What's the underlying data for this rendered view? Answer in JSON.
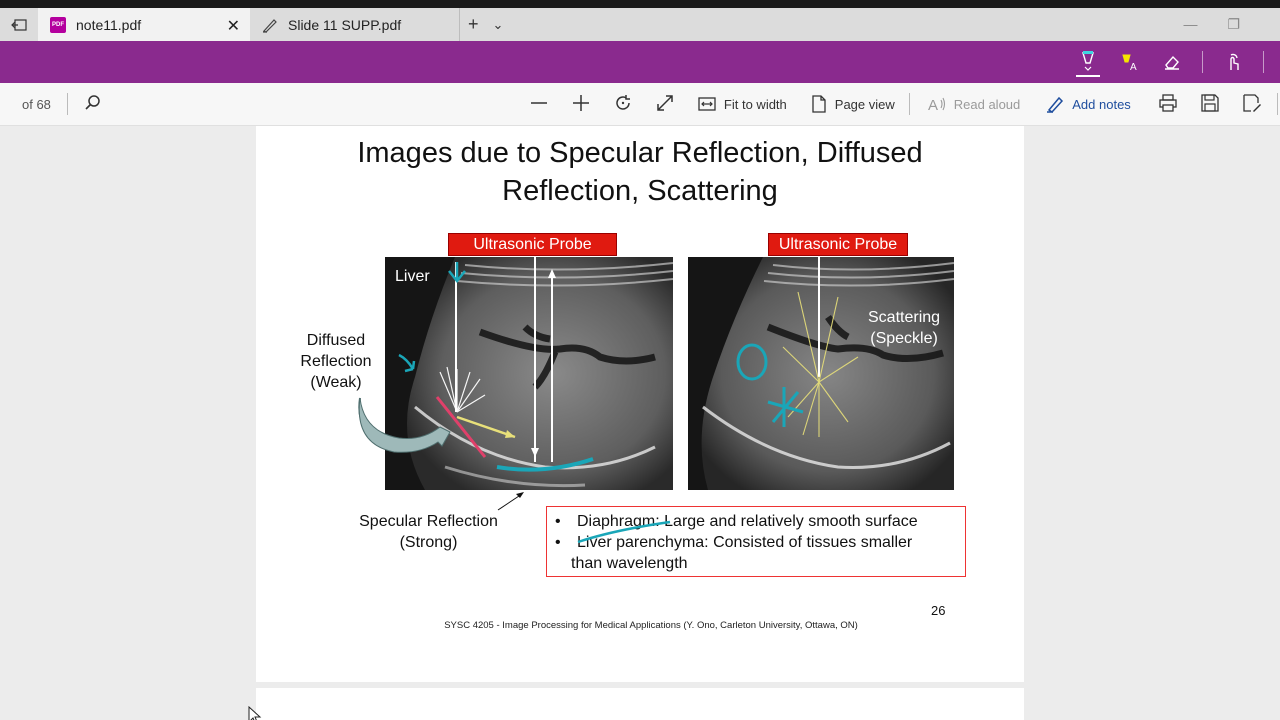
{
  "tabs": [
    {
      "label": "note11.pdf",
      "active": true,
      "icon": "pdf-icon"
    },
    {
      "label": "Slide 11 SUPP.pdf",
      "active": false,
      "icon": "ink-pen-icon"
    }
  ],
  "toolbar": {
    "page_count": "of 68",
    "fit_to_width": "Fit to width",
    "page_view": "Page view",
    "read_aloud": "Read aloud",
    "add_notes": "Add notes"
  },
  "slide": {
    "title_line1": "Images due to Specular Reflection, Diffused",
    "title_line2": "Reflection, Scattering",
    "probe_left": "Ultrasonic Probe",
    "probe_right": "Ultrasonic Probe",
    "liver_label": "Liver",
    "scattering_line1": "Scattering",
    "scattering_line2": "(Speckle)",
    "diffused_line1": "Diffused",
    "diffused_line2": "Reflection",
    "diffused_line3": "(Weak)",
    "specular_line1": "Specular Reflection",
    "specular_line2": "(Strong)",
    "bullet1": "Diaphragm: Large and relatively smooth surface",
    "bullet2_line1": "Liver parenchyma: Consisted of tissues smaller",
    "bullet2_line2": "than wavelength",
    "bullet_char": "•",
    "page_number": "26",
    "footer": "SYSC 4205 - Image Processing for Medical Applications (Y. Ono, Carleton University, Ottawa, ON)"
  },
  "colors": {
    "ink_bar": "#8a2a8e",
    "accent_blue": "#1f4e9e",
    "probe_red": "#e01a10",
    "annotation_teal": "#1aa6b8",
    "annotation_pink": "#e0406a",
    "annotation_yellow": "#e8e07a"
  }
}
